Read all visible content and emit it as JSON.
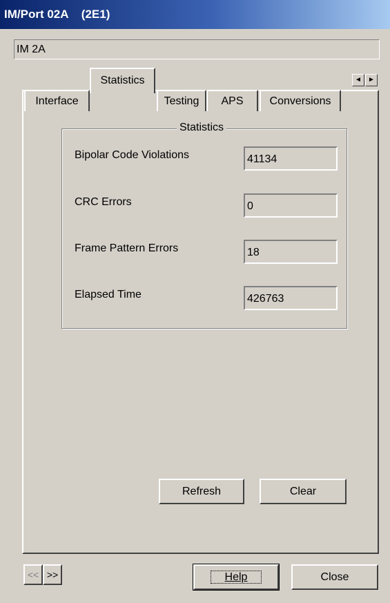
{
  "window": {
    "title": "IM/Port 02A    (2E1)"
  },
  "name_field": {
    "value": "IM 2A"
  },
  "tabs": [
    {
      "label": "Interface"
    },
    {
      "label": "Statistics"
    },
    {
      "label": "Testing"
    },
    {
      "label": "APS"
    },
    {
      "label": "Conversions"
    }
  ],
  "tab_scroll": {
    "left": "◄",
    "right": "►"
  },
  "statistics": {
    "group_title": "Statistics",
    "rows": [
      {
        "label": "Bipolar Code Violations",
        "value": "41134"
      },
      {
        "label": "CRC Errors",
        "value": "0"
      },
      {
        "label": "Frame Pattern Errors",
        "value": "18"
      },
      {
        "label": "Elapsed Time",
        "value": "426763"
      }
    ]
  },
  "buttons": {
    "refresh": "Refresh",
    "clear": "Clear",
    "help": "Help",
    "close": "Close",
    "prev": "<<",
    "next": ">>"
  },
  "colors": {
    "title_start": "#0a246a",
    "title_end": "#a6caf0",
    "face": "#d4d0c8"
  }
}
